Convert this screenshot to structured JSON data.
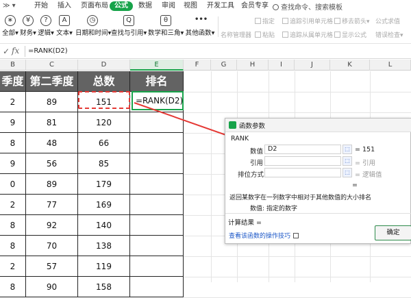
{
  "menubar": {
    "items": [
      "开始",
      "插入",
      "页面布局",
      "公式",
      "数据",
      "审阅",
      "视图",
      "开发工具",
      "会员专享"
    ],
    "active": "公式",
    "search": "查找命令、搜索模板"
  },
  "ribbon": {
    "buttons": [
      {
        "label": "全部▾",
        "icon": "∗"
      },
      {
        "label": "财务▾",
        "icon": "¥"
      },
      {
        "label": "逻辑▾",
        "icon": "?"
      },
      {
        "label": "文本▾",
        "icon": "A"
      },
      {
        "label": "日期和时间▾",
        "icon": "◷"
      },
      {
        "label": "查找与引用▾",
        "icon": "Q"
      },
      {
        "label": "数学和三角▾",
        "icon": "θ"
      },
      {
        "label": "其他函数▾",
        "icon": "•••"
      }
    ],
    "name_manager": "名称管理器",
    "small": [
      "指定",
      "粘贴",
      "追踪引用单元格",
      "追踪从属单元格",
      "移去箭头▾",
      "显示公式",
      "公式求值",
      "错误检查▾"
    ]
  },
  "formula_bar": {
    "text": "=RANK(D2)"
  },
  "columns": [
    "B",
    "C",
    "D",
    "E",
    "F",
    "G",
    "H",
    "I",
    "J",
    "K",
    "L"
  ],
  "table": {
    "headers": [
      "季度",
      "第二季度",
      "总数",
      "排名"
    ],
    "rows": [
      [
        "2",
        "89",
        "151"
      ],
      [
        "9",
        "81",
        "120"
      ],
      [
        "8",
        "48",
        "66"
      ],
      [
        "9",
        "56",
        "85"
      ],
      [
        "0",
        "89",
        "179"
      ],
      [
        "2",
        "77",
        "169"
      ],
      [
        "8",
        "92",
        "140"
      ],
      [
        "8",
        "70",
        "138"
      ],
      [
        "2",
        "57",
        "119"
      ],
      [
        "8",
        "90",
        "158"
      ]
    ],
    "edit_cell": "=RANK(D2)"
  },
  "dialog": {
    "title": "函数参数",
    "function": "RANK",
    "fields": [
      {
        "label": "数值",
        "value": "D2",
        "result": "= 151"
      },
      {
        "label": "引用",
        "value": "",
        "result": "= 引用"
      },
      {
        "label": "排位方式",
        "value": "",
        "result": "= 逻辑值"
      }
    ],
    "equals": "=",
    "description": "返回某数字在一列数字中相对于其他数值的大小排名",
    "param_help_label": "数值:",
    "param_help": "指定的数字",
    "calc_result_label": "计算结果 =",
    "help_link": "查看该函数的操作技巧",
    "ok": "确定"
  },
  "colors": {
    "accent": "#17a34a",
    "header_fill": "#636363",
    "arrow": "#e53935"
  }
}
